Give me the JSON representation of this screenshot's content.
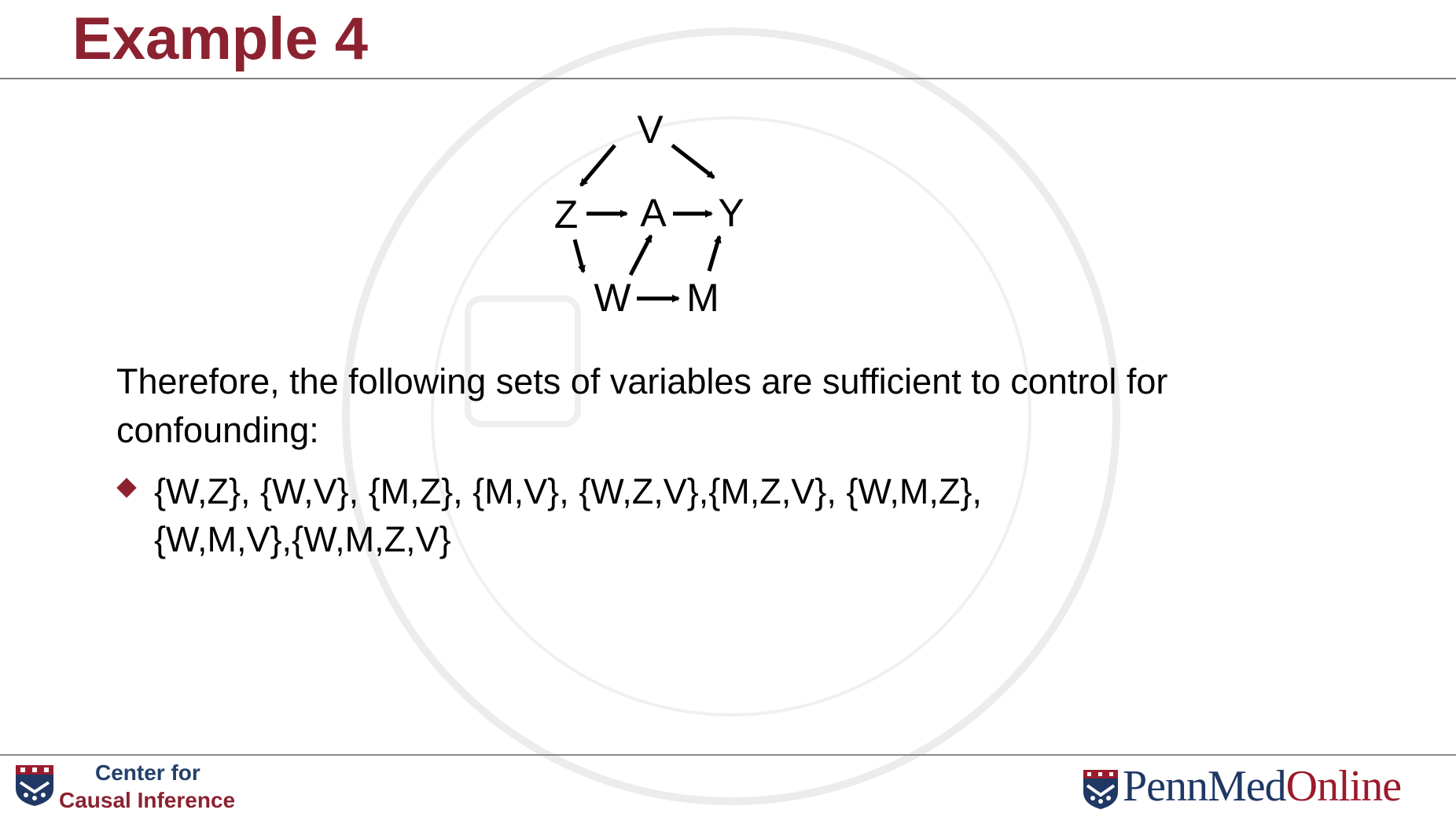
{
  "slide": {
    "title": "Example 4",
    "statement": "Therefore, the following sets of variables are sufficient to control for confounding:",
    "sets_line1": "{W,Z}, {W,V}, {M,Z}, {M,V}, {W,Z,V},{M,Z,V}, {W,M,Z},",
    "sets_line2": "{W,M,V},{W,M,Z,V}"
  },
  "diagram": {
    "nodes": {
      "v": "V",
      "z": "Z",
      "a": "A",
      "y": "Y",
      "w": "W",
      "m": "M"
    }
  },
  "footer": {
    "center_line1": "Center for",
    "center_line2": "Causal Inference",
    "brand_penn_med": "PennMed",
    "brand_online": "Online"
  },
  "colors": {
    "title": "#8c2230",
    "bullet": "#8c2230",
    "footer_blue": "#1f3864",
    "footer_red": "#9b1b2d"
  },
  "icons": {
    "bullet": "diamond-bullet-icon",
    "left_logo": "penn-shield-icon",
    "right_logo": "penn-shield-icon"
  }
}
